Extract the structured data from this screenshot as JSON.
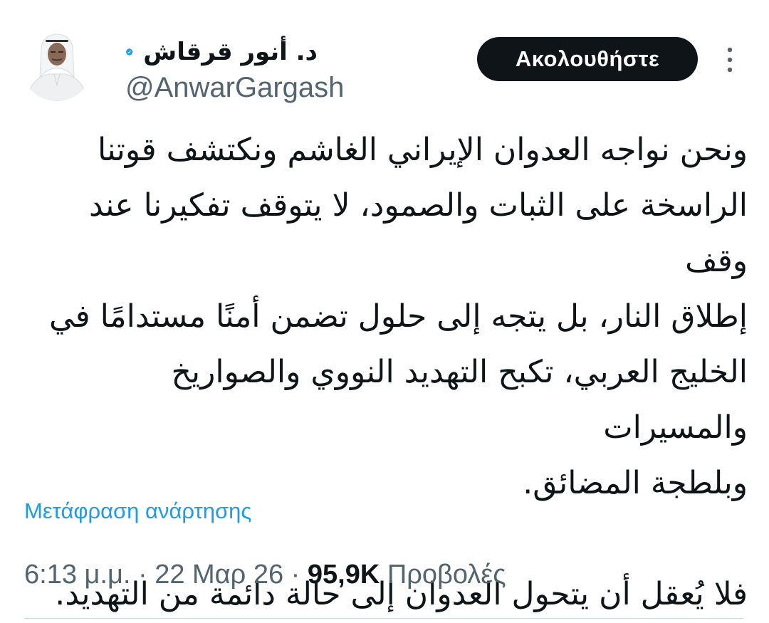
{
  "author": {
    "display_name": "د. أنور قرقاش",
    "handle": "@AnwarGargash",
    "verified": true
  },
  "follow_button": {
    "label": "Ακολουθήστε"
  },
  "icons": {
    "more": "more-vertical-icon",
    "verified": "verified-badge-icon"
  },
  "tweet": {
    "paragraphs": [
      "ونحن نواجه العدوان الإيراني الغاشم ونكتشف قوتنا\nالراسخة على الثبات والصمود، لا يتوقف تفكيرنا عند وقف\nإطلاق النار، بل يتجه إلى حلول تضمن أمنًا مستدامًا في\nالخليج العربي، تكبح التهديد النووي والصواريخ والمسيرات\nوبلطجة المضائق.",
      "فلا يُعقل أن يتحول العدوان إلى حالة دائمة من التهديد."
    ]
  },
  "translate_link": "Μετάφραση ανάρτησης",
  "meta": {
    "time": "6:13 μ.μ.",
    "separator": "·",
    "date": "22 Μαρ 26",
    "views_count": "95,9K",
    "views_label": "Προβολές"
  },
  "colors": {
    "text": "#0f1419",
    "secondary_text": "#536471",
    "link": "#1d9bf0",
    "verified": "#1d9bf0",
    "button_bg": "#0f1419",
    "button_text": "#ffffff",
    "divider": "#cfd9de"
  }
}
